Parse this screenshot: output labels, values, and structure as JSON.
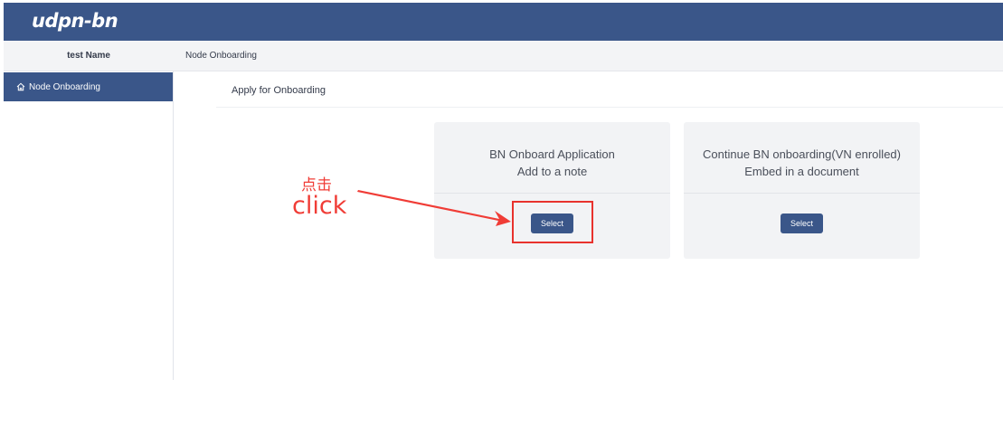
{
  "app": {
    "logo": "udpn-bn"
  },
  "sidebar": {
    "user_name": "test Name",
    "items": [
      {
        "label": "Node Onboarding",
        "icon": "home-icon",
        "active": true
      }
    ]
  },
  "breadcrumb": "Node Onboarding",
  "section": {
    "title": "Apply for Onboarding"
  },
  "cards": [
    {
      "line1": "BN Onboard Application",
      "line2": "Add to a note",
      "button_label": "Select"
    },
    {
      "line1": "Continue BN onboarding(VN enrolled)",
      "line2": "Embed in a document",
      "button_label": "Select"
    }
  ],
  "annotation": {
    "label_cn": "点击",
    "label_en": "click",
    "color": "#f03c36"
  },
  "colors": {
    "primary": "#3a5689",
    "annotation_red": "#e8322d"
  }
}
